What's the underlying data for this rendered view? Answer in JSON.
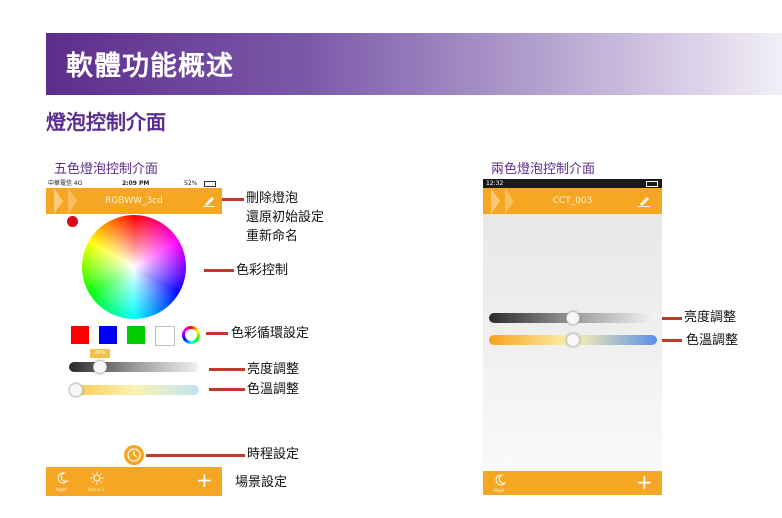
{
  "slide": {
    "banner_title": "軟體功能概述",
    "section_title": "燈泡控制介面"
  },
  "left_panel": {
    "label": "五色燈泡控制介面",
    "status": {
      "carrier": "中華電信 4G",
      "time": "2:09 PM",
      "battery": "52%"
    },
    "nav_title": "RGBWW_3cd",
    "swatches": [
      "#ff0000",
      "#0000ff",
      "#00cc00",
      "#ffffff"
    ],
    "brightness_badge": "24%",
    "brightness": 0.24,
    "color_temp": 0.0,
    "tabs": {
      "night": "Night",
      "scene": "Scene 1"
    },
    "add_symbol": "+"
  },
  "right_panel": {
    "label": "兩色燈泡控制介面",
    "status_time": "12:32",
    "nav_title": "CCT_003",
    "brightness": 0.5,
    "color_temp": 0.5,
    "tab_night": "Night",
    "add_symbol": "+"
  },
  "callouts": {
    "delete": "刪除燈泡",
    "reset": "還原初始設定",
    "rename": "重新命名",
    "color_control": "色彩控制",
    "color_cycle": "色彩循環設定",
    "brightness_left": "亮度調整",
    "temp_left": "色溫調整",
    "schedule": "時程設定",
    "scene": "場景設定",
    "brightness_right": "亮度調整",
    "temp_right": "色溫調整"
  },
  "colors": {
    "accent": "#f5a623",
    "title_purple": "#5b2d8e",
    "callout_red": "#c0392b"
  }
}
